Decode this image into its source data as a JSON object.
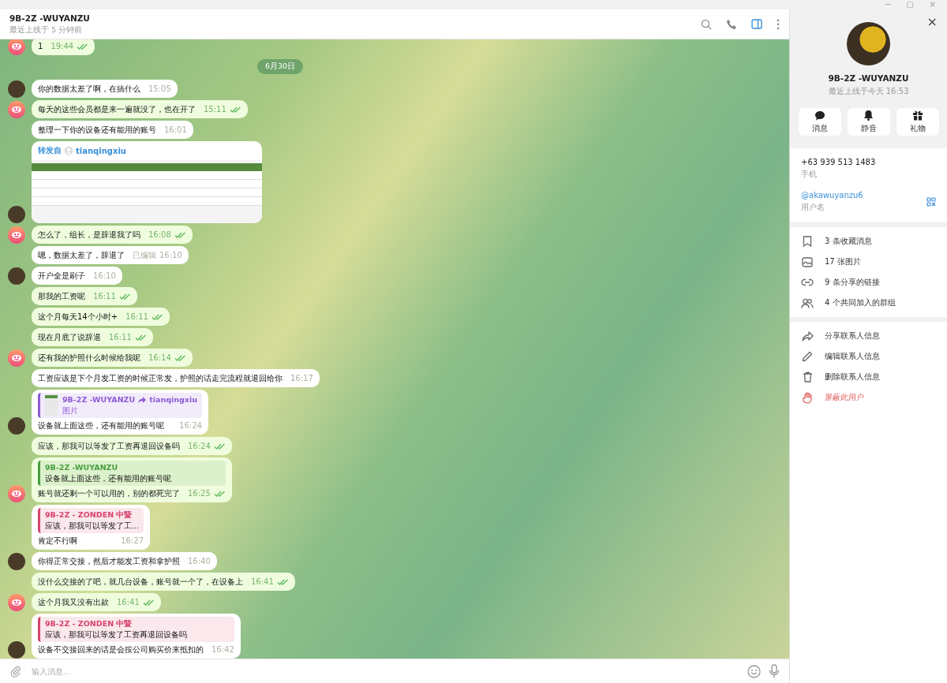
{
  "window": {
    "controls": [
      "─",
      "▢",
      "×"
    ]
  },
  "header": {
    "title": "9B-2Z -WUYANZU",
    "status": "最近上线于 5 分钟前"
  },
  "messages": [
    {
      "kind": "message",
      "outgoing": true,
      "text": "1",
      "time": "19:44",
      "read": true,
      "avatar": true
    },
    {
      "kind": "date",
      "text": "6月30日"
    },
    {
      "kind": "message",
      "outgoing": false,
      "text": "你的数据太差了啊，在搞什么",
      "time": "15:05",
      "read": false,
      "avatar": true
    },
    {
      "kind": "message",
      "outgoing": true,
      "text": "每天的这些会员都是来一遍就没了，也在开了",
      "time": "15:11",
      "read": true,
      "avatar": true
    },
    {
      "kind": "message",
      "outgoing": false,
      "text": "整理一下你的设备还有能用的账号",
      "time": "16:01",
      "read": false,
      "avatar": false
    },
    {
      "kind": "forward",
      "outgoing": false,
      "label": "转发自",
      "from": "tianqingxiu",
      "avatar": true
    },
    {
      "kind": "message",
      "outgoing": true,
      "text": "怎么了，组长，是辞退我了吗",
      "time": "16:08",
      "read": true,
      "avatar": true
    },
    {
      "kind": "message",
      "outgoing": false,
      "text": "嗯，数据太差了，辞退了",
      "edited": "已编辑",
      "time": "16:10",
      "read": false,
      "avatar": false
    },
    {
      "kind": "message",
      "outgoing": false,
      "text": "开户全是刷子",
      "time": "16:10",
      "read": false,
      "avatar": true
    },
    {
      "kind": "message",
      "outgoing": true,
      "text": "那我的工资呢",
      "time": "16:11",
      "read": true,
      "avatar": false
    },
    {
      "kind": "message",
      "outgoing": true,
      "text": "这个月每天14个小时+",
      "time": "16:11",
      "read": true,
      "avatar": false
    },
    {
      "kind": "message",
      "outgoing": true,
      "text": "现在月底了说辞退",
      "time": "16:11",
      "read": true,
      "avatar": false
    },
    {
      "kind": "message",
      "outgoing": true,
      "text": "还有我的护照什么时候给我呢",
      "time": "16:14",
      "read": true,
      "avatar": true
    },
    {
      "kind": "message",
      "outgoing": false,
      "text": "工资应该是下个月发工资的时候正常发，护照的话走完流程就退回给你",
      "time": "16:17",
      "read": false,
      "avatar": false
    },
    {
      "kind": "message",
      "outgoing": false,
      "reply": {
        "name": "9B-2Z -WUYANZU",
        "via": "tianqingxiu",
        "text": "图片",
        "color": "#8e5bd6"
      },
      "text": "设备就上面这些，还有能用的账号呢",
      "time": "16:24",
      "read": false,
      "avatar": true
    },
    {
      "kind": "message",
      "outgoing": true,
      "text": "应该，那我可以等发了工资再退回设备吗",
      "time": "16:24",
      "read": true,
      "avatar": false
    },
    {
      "kind": "message",
      "outgoing": true,
      "reply": {
        "name": "9B-2Z -WUYANZU",
        "text": "设备就上面这些，还有能用的账号呢",
        "color": "#4a9e3f"
      },
      "text": "账号就还剩一个可以用的，别的都死完了",
      "time": "16:25",
      "read": true,
      "avatar": true
    },
    {
      "kind": "message",
      "outgoing": false,
      "reply": {
        "name": "9B-2Z - ZONDEN 中暨",
        "text": "应该，那我可以等发了工...",
        "color": "#d8436e"
      },
      "text": "肯定不行啊",
      "time": "16:27",
      "read": false,
      "avatar": false
    },
    {
      "kind": "message",
      "outgoing": false,
      "text": "你得正常交接，然后才能发工资和拿护照",
      "time": "16:40",
      "read": false,
      "avatar": true
    },
    {
      "kind": "message",
      "outgoing": true,
      "text": "没什么交接的了吧，就几台设备，账号就一个了，在设备上",
      "time": "16:41",
      "read": true,
      "avatar": false
    },
    {
      "kind": "message",
      "outgoing": true,
      "text": "这个月我又没有出款",
      "time": "16:41",
      "read": true,
      "avatar": true
    },
    {
      "kind": "message",
      "outgoing": false,
      "reply": {
        "name": "9B-2Z - ZONDEN 中暨",
        "text": "应该，那我可以等发了工资再退回设备吗",
        "color": "#d8436e"
      },
      "text": "设备不交接回来的话是会按公司购买价来抵扣的",
      "time": "16:42",
      "read": false,
      "avatar": true
    }
  ],
  "composer": {
    "placeholder": "输入消息..."
  },
  "profile": {
    "close": "×",
    "name": "9B-2Z -WUYANZU",
    "status": "最近上线于今天 16:53",
    "actions": [
      {
        "kind": "message",
        "label": "消息"
      },
      {
        "kind": "mute",
        "label": "静音"
      },
      {
        "kind": "gift",
        "label": "礼物"
      }
    ],
    "info": [
      {
        "kind": "phone",
        "value": "+63 939 513 1483",
        "label": "手机"
      },
      {
        "kind": "username",
        "value": "@akawuyanzu6",
        "label": "用户名"
      }
    ],
    "media": [
      {
        "kind": "saved",
        "label": "3 条收藏消息"
      },
      {
        "kind": "photos",
        "label": "17 张图片"
      },
      {
        "kind": "links",
        "label": "9 条分享的链接"
      },
      {
        "kind": "groups",
        "label": "4 个共同加入的群组"
      }
    ],
    "manage": [
      {
        "kind": "share",
        "label": "分享联系人信息",
        "danger": false
      },
      {
        "kind": "edit",
        "label": "编辑联系人信息",
        "danger": false
      },
      {
        "kind": "delete",
        "label": "删除联系人信息",
        "danger": false
      },
      {
        "kind": "block",
        "label": "屏蔽此用户",
        "danger": true
      }
    ]
  }
}
